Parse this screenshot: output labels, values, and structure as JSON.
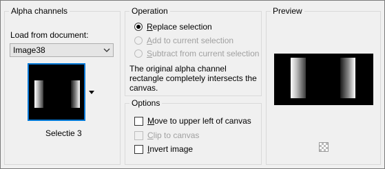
{
  "alpha_channels": {
    "title": "Alpha channels",
    "load_from_label": "Load from document:",
    "document_selected": "Image38",
    "thumbnail_caption": "Selectie 3"
  },
  "operation": {
    "title": "Operation",
    "options": [
      {
        "label": "Replace selection",
        "checked": true,
        "enabled": true
      },
      {
        "label": "Add to current selection",
        "checked": false,
        "enabled": false
      },
      {
        "label": "Subtract from current selection",
        "checked": false,
        "enabled": false
      }
    ],
    "description": "The original alpha channel rectangle completely intersects the canvas."
  },
  "options": {
    "title": "Options",
    "items": [
      {
        "label": "Move to upper left of canvas",
        "checked": false,
        "enabled": true
      },
      {
        "label": "Clip to canvas",
        "checked": false,
        "enabled": false
      },
      {
        "label": "Invert image",
        "checked": false,
        "enabled": true
      }
    ]
  },
  "preview": {
    "title": "Preview"
  },
  "colors": {
    "accent": "#0078d7",
    "disabled_text": "#a0a0a0"
  }
}
